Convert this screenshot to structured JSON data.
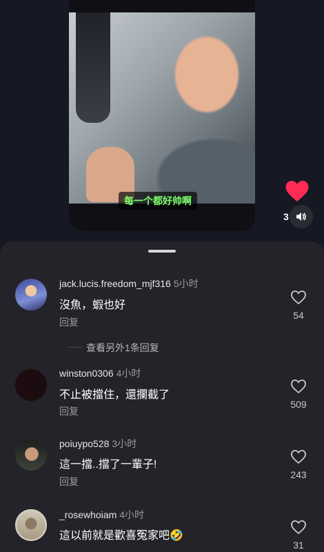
{
  "video": {
    "subtitle": "每一个都好帅啊"
  },
  "side_actions": {
    "like_count": "3",
    "heart_color": "#fe2c55"
  },
  "comments": [
    {
      "username": "jack.lucis.freedom_mjf316",
      "time": "5小时",
      "text": "沒魚，蝦也好",
      "reply_label": "回复",
      "likes": "54",
      "more_replies": "查看另外1条回复"
    },
    {
      "username": "winston0306",
      "time": "4小时",
      "text": "不止被擋住，還攔截了",
      "reply_label": "回复",
      "likes": "509"
    },
    {
      "username": "poiuypo528",
      "time": "3小时",
      "text": "這一擋..擋了一輩子!",
      "reply_label": "回复",
      "likes": "243"
    },
    {
      "username": "_rosewhoiam",
      "time": "4小时",
      "text": "這以前就是歡喜冤家吧🤣",
      "likes": "31"
    }
  ],
  "icons": {
    "heart": "heart-icon",
    "sound": "speaker-icon",
    "like": "heart-outline-icon"
  }
}
